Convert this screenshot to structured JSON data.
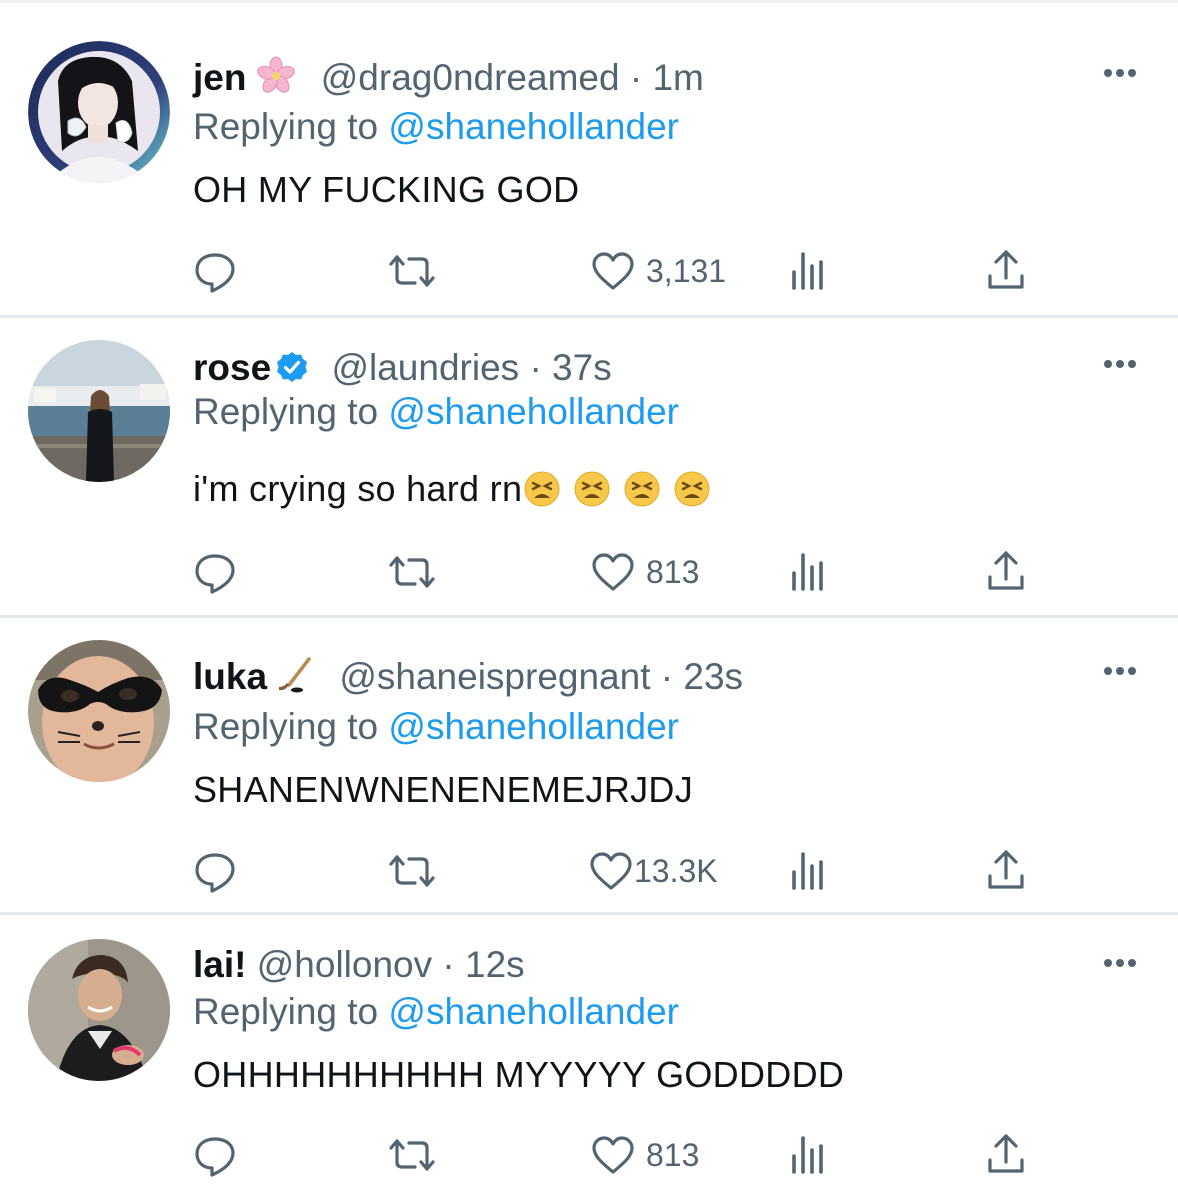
{
  "tweets": [
    {
      "name": "jen",
      "handle": "@drag0ndreamed",
      "dot": "·",
      "time": "1m",
      "replying_label": "Replying to",
      "replying_to": "@shanehollander",
      "text": "OH MY FUCKING GOD",
      "likes": "3,131",
      "name_icon": "cherry-blossom-icon"
    },
    {
      "name": "rose",
      "handle": "@laundries",
      "dot": "·",
      "time": "37s",
      "replying_label": "Replying to",
      "replying_to": "@shanehollander",
      "text": "i'm crying so hard rn",
      "likes": "813",
      "name_icon": "verified-badge-icon",
      "text_emojis": [
        "tired-face-emoji",
        "tired-face-emoji",
        "tired-face-emoji",
        "tired-face-emoji"
      ]
    },
    {
      "name": "luka",
      "handle": "@shaneispregnant",
      "dot": "·",
      "time": "23s",
      "replying_label": "Replying to",
      "replying_to": "@shanehollander",
      "text": "SHANENWNENENEMEJRJDJ",
      "likes": "13.3K",
      "name_icon": "hockey-stick-icon"
    },
    {
      "name": "lai!",
      "handle": "@hollonov",
      "dot": "·",
      "time": "12s",
      "replying_label": "Replying to",
      "replying_to": "@shanehollander",
      "text": "OHHHHHHHHHH MYYYYY GODDDDD",
      "likes": "813"
    }
  ],
  "colors": {
    "link": "#1d9bf0",
    "secondary": "#536471",
    "text": "#0f1419",
    "divider": "#e6e9eb"
  }
}
